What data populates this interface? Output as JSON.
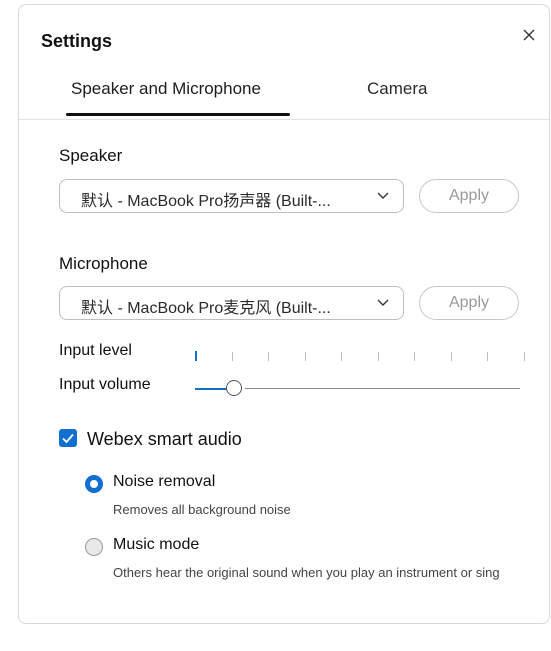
{
  "dialog": {
    "title": "Settings",
    "close_icon": "close-icon"
  },
  "tabs": [
    {
      "label": "Speaker and Microphone",
      "active": true
    },
    {
      "label": "Camera",
      "active": false
    }
  ],
  "speaker": {
    "label": "Speaker",
    "selected": "默认 - MacBook Pro扬声器 (Built-...",
    "apply_label": "Apply"
  },
  "microphone": {
    "label": "Microphone",
    "selected": "默认 - MacBook Pro麦克风 (Built-...",
    "apply_label": "Apply"
  },
  "input_level": {
    "label": "Input level",
    "tick_count": 10,
    "active_ticks": 1
  },
  "input_volume": {
    "label": "Input volume",
    "value_fraction": 0.12
  },
  "smart_audio": {
    "label": "Webex smart audio",
    "checked": true
  },
  "noise_removal": {
    "label": "Noise removal",
    "description": "Removes all background noise",
    "selected": true
  },
  "music_mode": {
    "label": "Music mode",
    "description": "Others hear the original sound when you play an instrument or sing",
    "selected": false
  },
  "colors": {
    "accent": "#1170cf",
    "text": "#111111",
    "muted": "#9a9a9a"
  }
}
